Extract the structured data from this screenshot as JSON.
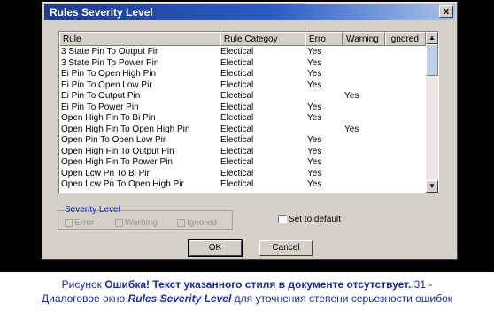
{
  "window": {
    "title": "Rules Severity Level",
    "close_glyph": "x"
  },
  "listview": {
    "columns": [
      "Rule",
      "Rule Categoy",
      "Erro",
      "Warning",
      "Ignored"
    ],
    "rows": [
      {
        "rule": "3 State Pin To Output Fir",
        "category": "Electical",
        "error": "Yes",
        "warning": "",
        "ignored": ""
      },
      {
        "rule": "3 State Pin To Power Pin",
        "category": "Electical",
        "error": "Yes",
        "warning": "",
        "ignored": ""
      },
      {
        "rule": "Ei Pin To Open High Pin",
        "category": "Electical",
        "error": "Yes",
        "warning": "",
        "ignored": ""
      },
      {
        "rule": "Ei Pin To Open Low Pir",
        "category": "Electical",
        "error": "Yes",
        "warning": "",
        "ignored": ""
      },
      {
        "rule": "Ei Pin To Output Pin",
        "category": "Electical",
        "error": "",
        "warning": "Yes",
        "ignored": ""
      },
      {
        "rule": "Ei Pin To Power Pin",
        "category": "Electical",
        "error": "Yes",
        "warning": "",
        "ignored": ""
      },
      {
        "rule": "Open High Fin To Bi Pin",
        "category": "Electical",
        "error": "Yes",
        "warning": "",
        "ignored": ""
      },
      {
        "rule": "Open High Fin To Open High Pin",
        "category": "Electical",
        "error": "",
        "warning": "Yes",
        "ignored": ""
      },
      {
        "rule": "Open Pin To Open Low Pir",
        "category": "Electical",
        "error": "Yes",
        "warning": "",
        "ignored": ""
      },
      {
        "rule": "Open High Fin To Output Pin",
        "category": "Electical",
        "error": "Yes",
        "warning": "",
        "ignored": ""
      },
      {
        "rule": "Open High Fin To Power Pin",
        "category": "Electical",
        "error": "Yes",
        "warning": "",
        "ignored": ""
      },
      {
        "rule": "Open Lcw Pn To Bi Pir",
        "category": "Electical",
        "error": "Yes",
        "warning": "",
        "ignored": ""
      },
      {
        "rule": "Open Lcw Pn To Open High Pir",
        "category": "Electical",
        "error": "Yes",
        "warning": "",
        "ignored": ""
      }
    ],
    "scroll_up_glyph": "▲",
    "scroll_down_glyph": "▼"
  },
  "severity": {
    "group_label": "Severity Level",
    "options": [
      "Error",
      "Warning",
      "Ignored"
    ],
    "set_to_default": "Set to default"
  },
  "buttons": {
    "ok": "OK",
    "cancel": "Cancel"
  },
  "caption": {
    "prefix": "Рисунок ",
    "error_bold": "Ошибка! Текст указанного стиля в документе отсутствует.",
    "number": ".31 -",
    "line2_start": "Диалоговое окно ",
    "dialog_name": "Rules Severity Level",
    "line2_end": " для уточнения степени серьезности ошибок"
  }
}
